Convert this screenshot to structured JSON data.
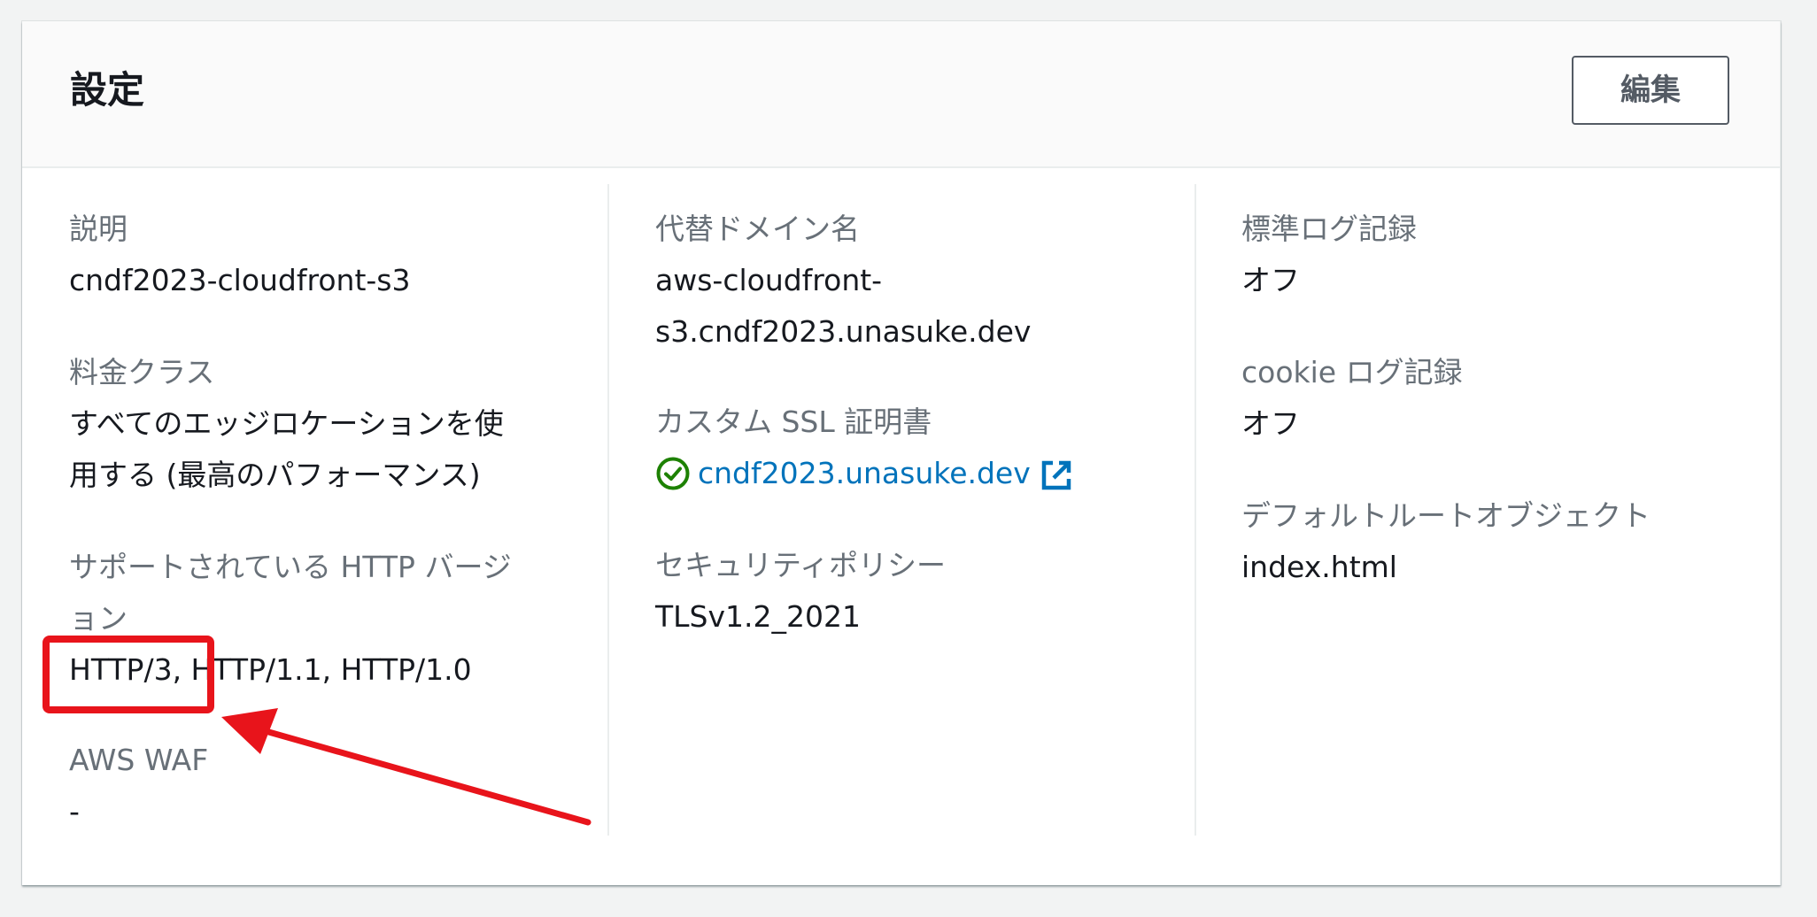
{
  "panel": {
    "title": "設定",
    "edit_label": "編集"
  },
  "column1": {
    "description_label": "説明",
    "description_value": "cndf2023-cloudfront-s3",
    "price_class_label": "料金クラス",
    "price_class_value_line1": "すべてのエッジロケーションを使",
    "price_class_value_line2": "用する (最高のパフォーマンス)",
    "http_versions_label_line1": "サポートされている HTTP バージ",
    "http_versions_label_line2": "ョン",
    "http_versions_value": "HTTP/3, HTTP/1.1, HTTP/1.0",
    "waf_label": "AWS WAF",
    "waf_value": "-"
  },
  "column2": {
    "alt_domain_label": "代替ドメイン名",
    "alt_domain_value_line1": "aws-cloudfront-",
    "alt_domain_value_line2": "s3.cndf2023.unasuke.dev",
    "ssl_cert_label": "カスタム SSL 証明書",
    "ssl_cert_value": "cndf2023.unasuke.dev",
    "ssl_status_icon": "check-circle-icon",
    "ssl_link_icon": "external-link-icon",
    "security_policy_label": "セキュリティポリシー",
    "security_policy_value": "TLSv1.2_2021"
  },
  "column3": {
    "standard_logging_label": "標準ログ記録",
    "standard_logging_value": "オフ",
    "cookie_logging_label": "cookie ログ記録",
    "cookie_logging_value": "オフ",
    "default_root_label": "デフォルトルートオブジェクト",
    "default_root_value": "index.html"
  },
  "annotation": {
    "color": "#e8141b",
    "shapes": [
      "highlight-box",
      "arrow"
    ]
  },
  "colors": {
    "link": "#0073bb",
    "success": "#1d8102",
    "label": "#687078",
    "text": "#16191f"
  }
}
